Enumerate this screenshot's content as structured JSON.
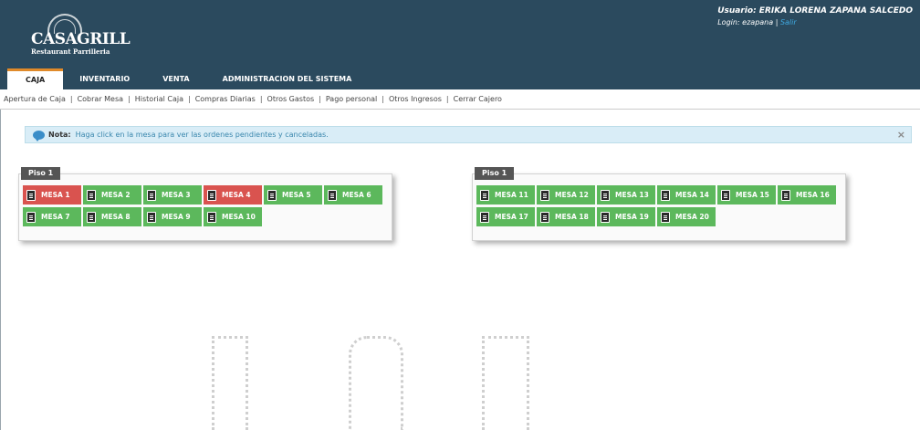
{
  "brand": {
    "name": "CASAGRILL",
    "subtitle": "Restaurant Parrilleria"
  },
  "user": {
    "name": "Usuario: ERIKA LORENA ZAPANA SALCEDO",
    "login_prefix": "Login: ezapana |",
    "logout_label": "Salir"
  },
  "tabs": [
    {
      "label": "CAJA",
      "active": true
    },
    {
      "label": "INVENTARIO",
      "active": false
    },
    {
      "label": "VENTA",
      "active": false
    },
    {
      "label": "ADMINISTRACION DEL SISTEMA",
      "active": false
    }
  ],
  "submenu": [
    "Apertura de Caja",
    "Cobrar Mesa",
    "Historial Caja",
    "Compras Diarias",
    "Otros Gastos",
    "Pago personal",
    "Otros Ingresos",
    "Cerrar Cajero"
  ],
  "submenu_separator": "|",
  "note": {
    "label": "Nota:",
    "text": "Haga click en la mesa para ver las ordenes pendientes y canceladas.",
    "close_symbol": "×"
  },
  "colors": {
    "header": "#2b4a5e",
    "available": "#5cb85c",
    "occupied": "#d9534f",
    "active_tab_accent": "#e08a2a"
  },
  "floors": [
    {
      "label": "Piso 1",
      "tables": [
        {
          "label": "MESA 1",
          "status": "red"
        },
        {
          "label": "MESA 2",
          "status": "green"
        },
        {
          "label": "MESA 3",
          "status": "green"
        },
        {
          "label": "MESA 4",
          "status": "red"
        },
        {
          "label": "MESA 5",
          "status": "green"
        },
        {
          "label": "MESA 6",
          "status": "green"
        },
        {
          "label": "MESA 7",
          "status": "green"
        },
        {
          "label": "MESA 8",
          "status": "green"
        },
        {
          "label": "MESA 9",
          "status": "green"
        },
        {
          "label": "MESA 10",
          "status": "green"
        }
      ]
    },
    {
      "label": "Piso 1",
      "tables": [
        {
          "label": "MESA 11",
          "status": "green"
        },
        {
          "label": "MESA 12",
          "status": "green"
        },
        {
          "label": "MESA 13",
          "status": "green"
        },
        {
          "label": "MESA 14",
          "status": "green"
        },
        {
          "label": "MESA 15",
          "status": "green"
        },
        {
          "label": "MESA 16",
          "status": "green"
        },
        {
          "label": "MESA 17",
          "status": "green"
        },
        {
          "label": "MESA 18",
          "status": "green"
        },
        {
          "label": "MESA 19",
          "status": "green"
        },
        {
          "label": "MESA 20",
          "status": "green"
        }
      ]
    }
  ]
}
